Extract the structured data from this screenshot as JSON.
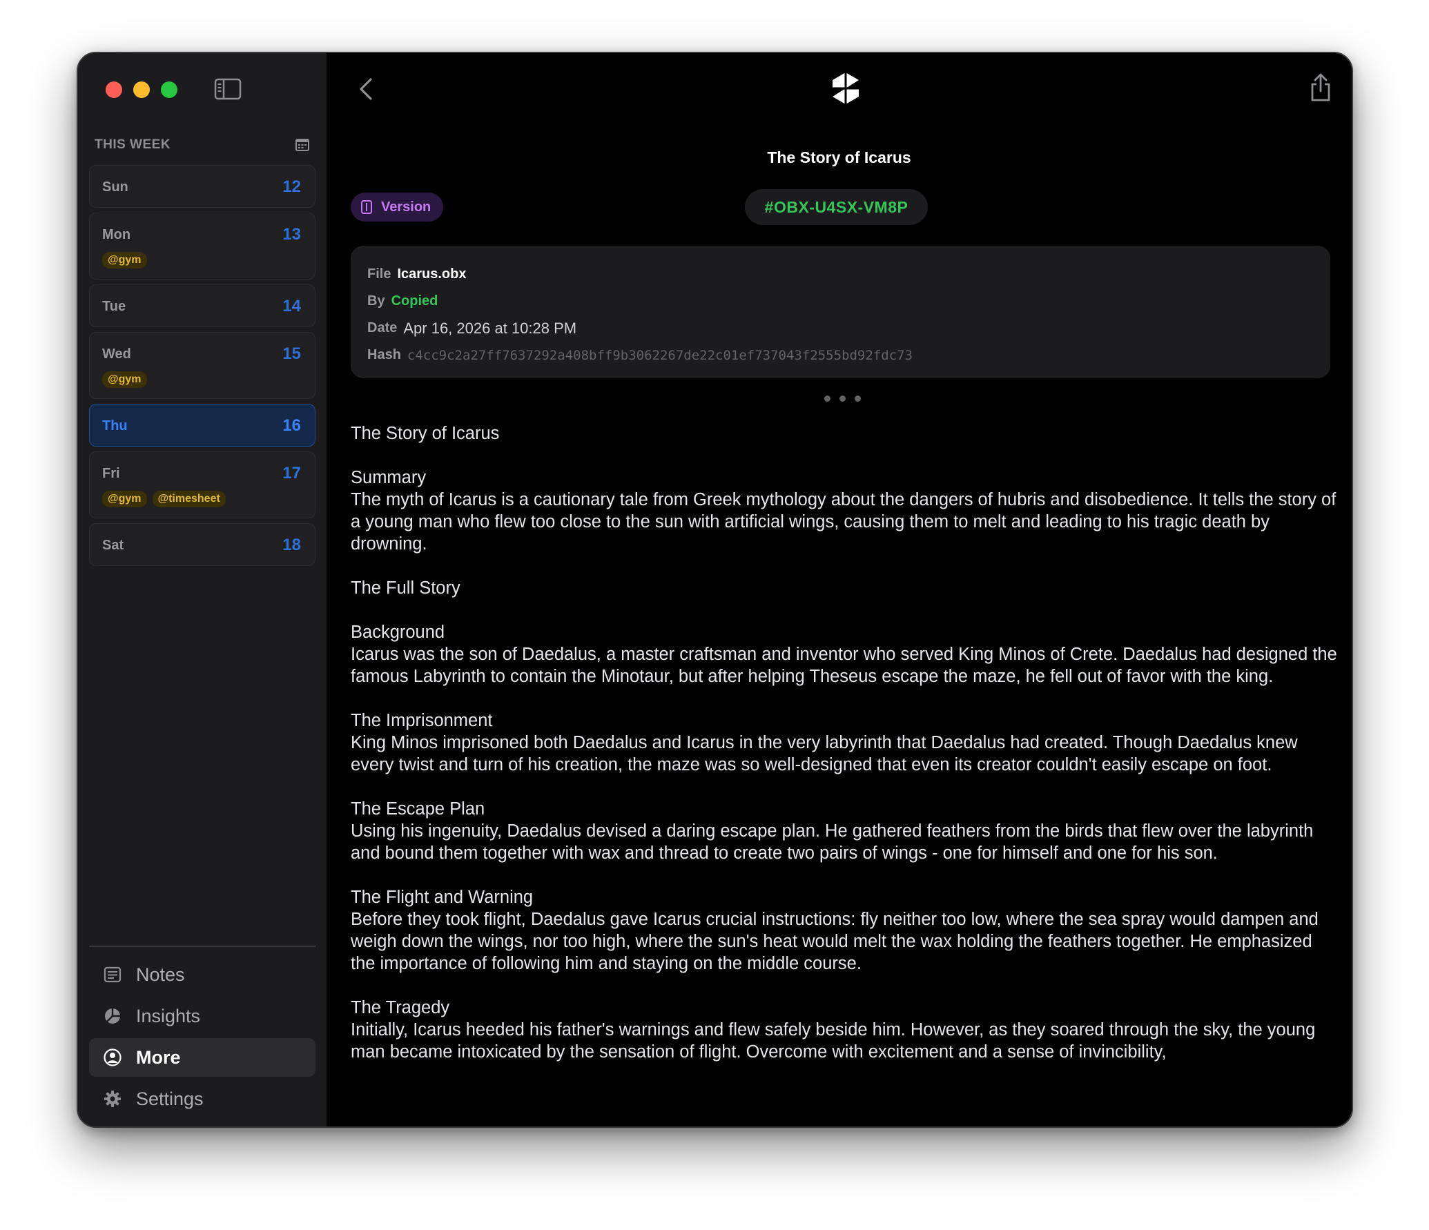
{
  "sidebar": {
    "week_label": "THIS WEEK",
    "days": [
      {
        "name": "Sun",
        "num": "12",
        "tags": []
      },
      {
        "name": "Mon",
        "num": "13",
        "tags": [
          "@gym"
        ]
      },
      {
        "name": "Tue",
        "num": "14",
        "tags": []
      },
      {
        "name": "Wed",
        "num": "15",
        "tags": [
          "@gym"
        ]
      },
      {
        "name": "Thu",
        "num": "16",
        "tags": [],
        "selected": true
      },
      {
        "name": "Fri",
        "num": "17",
        "tags": [
          "@gym",
          "@timesheet"
        ]
      },
      {
        "name": "Sat",
        "num": "18",
        "tags": []
      }
    ],
    "nav": {
      "notes": "Notes",
      "insights": "Insights",
      "more": "More",
      "settings": "Settings"
    }
  },
  "header": {
    "title": "The Story of Icarus"
  },
  "version_label": "Version",
  "hash_id": "#OBX-U4SX-VM8P",
  "meta": {
    "file_key": "File",
    "file_val": "Icarus.obx",
    "by_key": "By",
    "by_val": "Copied",
    "date_key": "Date",
    "date_val": "Apr 16, 2026 at 10:28 PM",
    "hash_key": "Hash",
    "hash_val": "c4cc9c2a27ff7637292a408bff9b3062267de22c01ef737043f2555bd92fdc73"
  },
  "content": {
    "title": "The Story of Icarus",
    "summary_heading": "Summary",
    "summary_text": "The myth of Icarus is a cautionary tale from Greek mythology about the dangers of hubris and disobedience. It tells the story of a young man who flew too close to the sun with artificial wings, causing them to melt and leading to his tragic death by drowning.",
    "full_story_heading": "The Full Story",
    "background_heading": "Background",
    "background_text": "Icarus was the son of Daedalus, a master craftsman and inventor who served King Minos of Crete. Daedalus had designed the famous Labyrinth to contain the Minotaur, but after helping Theseus escape the maze, he fell out of favor with the king.",
    "imprisonment_heading": "The Imprisonment",
    "imprisonment_text": "King Minos imprisoned both Daedalus and Icarus in the very labyrinth that Daedalus had created. Though Daedalus knew every twist and turn of his creation, the maze was so well-designed that even its creator couldn't easily escape on foot.",
    "escape_heading": "The Escape Plan",
    "escape_text": "Using his ingenuity, Daedalus devised a daring escape plan. He gathered feathers from the birds that flew over the labyrinth and bound them together with wax and thread to create two pairs of wings - one for himself and one for his son.",
    "flight_heading": "The Flight and Warning",
    "flight_text": "Before they took flight, Daedalus gave Icarus crucial instructions: fly neither too low, where the sea spray would dampen and weigh down the wings, nor too high, where the sun's heat would melt the wax holding the feathers together. He emphasized the importance of following him and staying on the middle course.",
    "tragedy_heading": "The Tragedy",
    "tragedy_text": "Initially, Icarus heeded his father's warnings and flew safely beside him. However, as they soared through the sky, the young man became intoxicated by the sensation of flight. Overcome with excitement and a sense of invincibility,"
  },
  "colors": {
    "accent_blue": "#3b82f6",
    "hash_green": "#34c759",
    "version_purple": "#c47bf0",
    "tag_yellow": "#e0b93a"
  },
  "icons": [
    "sidebar-toggle-icon",
    "calendar-icon",
    "chevron-left-icon",
    "app-logo-icon",
    "share-icon",
    "version-icon",
    "notes-icon",
    "insights-icon",
    "person-circle-icon",
    "gear-icon"
  ]
}
